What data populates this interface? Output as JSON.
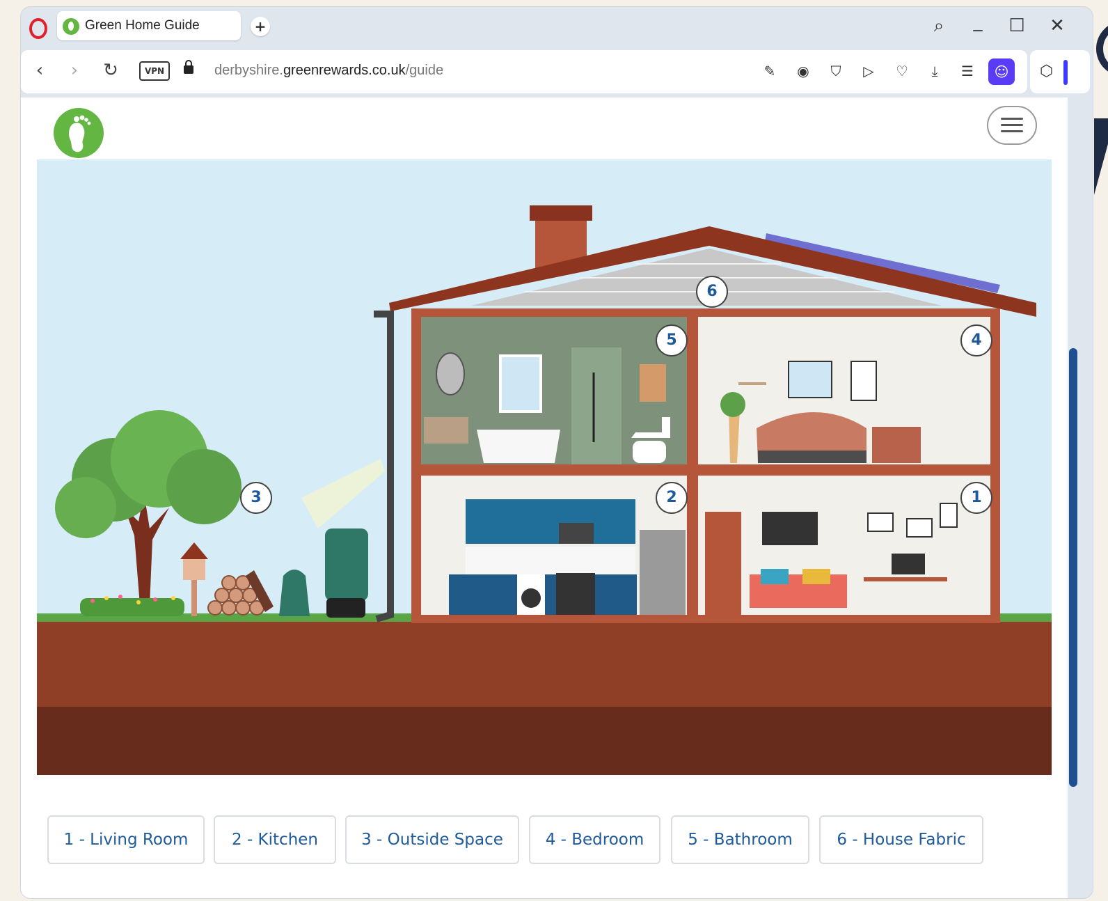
{
  "browser": {
    "tab_title": "Green Home Guide",
    "new_tab_label": "+",
    "url_prefix": "derbyshire.",
    "url_domain": "greenrewards.co.uk",
    "url_path": "/guide",
    "vpn_label": "VPN",
    "window_controls": {
      "minimize": "_",
      "maximize": "☐",
      "close": "✕",
      "search": "⌕"
    },
    "nav": {
      "back": "‹",
      "forward": "›",
      "reload": "↻"
    },
    "toolbar_icons": [
      "snap-icon",
      "camera-icon",
      "shield-icon",
      "send-icon",
      "heart-icon",
      "download-icon",
      "settings-icon"
    ],
    "accent": "#5b3cf6"
  },
  "site": {
    "brand_color": "#62b641",
    "link_color": "#1f5a9a"
  },
  "hotspots": [
    {
      "number": "1",
      "room": "living-room"
    },
    {
      "number": "2",
      "room": "kitchen"
    },
    {
      "number": "3",
      "room": "outside-space"
    },
    {
      "number": "4",
      "room": "bedroom"
    },
    {
      "number": "5",
      "room": "bathroom"
    },
    {
      "number": "6",
      "room": "house-fabric"
    }
  ],
  "room_buttons": [
    "1 - Living Room",
    "2 - Kitchen",
    "3 - Outside Space",
    "4 - Bedroom",
    "5 - Bathroom",
    "6 - House Fabric"
  ]
}
